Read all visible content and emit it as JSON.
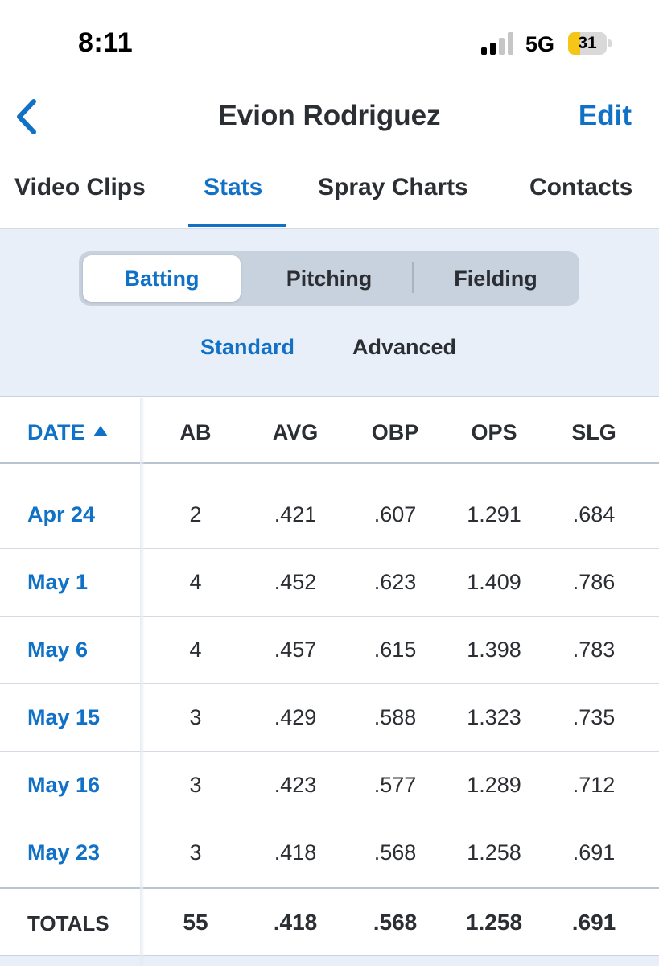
{
  "status_bar": {
    "time": "8:11",
    "network": "5G",
    "battery_level": "31",
    "battery_color": "#f5c518"
  },
  "header": {
    "title": "Evion Rodriguez",
    "back_icon": "chevron-left-icon",
    "edit_label": "Edit"
  },
  "tabs": [
    {
      "label": "Video Clips",
      "active": false
    },
    {
      "label": "Stats",
      "active": true
    },
    {
      "label": "Spray Charts",
      "active": false
    },
    {
      "label": "Contacts",
      "active": false
    }
  ],
  "filters": {
    "segments": [
      {
        "label": "Batting",
        "active": true
      },
      {
        "label": "Pitching",
        "active": false
      },
      {
        "label": "Fielding",
        "active": false
      }
    ],
    "subtabs": [
      {
        "label": "Standard",
        "active": true
      },
      {
        "label": "Advanced",
        "active": false
      }
    ]
  },
  "table": {
    "columns": [
      "DATE",
      "AB",
      "AVG",
      "OBP",
      "OPS",
      "SLG"
    ],
    "sort": {
      "column": "DATE",
      "direction": "ascending",
      "icon": "sort-up-icon"
    },
    "rows": [
      {
        "date": "Apr 24",
        "ab": "2",
        "avg": ".421",
        "obp": ".607",
        "ops": "1.291",
        "slg": ".684"
      },
      {
        "date": "May 1",
        "ab": "4",
        "avg": ".452",
        "obp": ".623",
        "ops": "1.409",
        "slg": ".786"
      },
      {
        "date": "May 6",
        "ab": "4",
        "avg": ".457",
        "obp": ".615",
        "ops": "1.398",
        "slg": ".783"
      },
      {
        "date": "May 15",
        "ab": "3",
        "avg": ".429",
        "obp": ".588",
        "ops": "1.323",
        "slg": ".735"
      },
      {
        "date": "May 16",
        "ab": "3",
        "avg": ".423",
        "obp": ".577",
        "ops": "1.289",
        "slg": ".712"
      },
      {
        "date": "May 23",
        "ab": "3",
        "avg": ".418",
        "obp": ".568",
        "ops": "1.258",
        "slg": ".691"
      }
    ],
    "totals": {
      "label": "TOTALS",
      "ab": "55",
      "avg": ".418",
      "obp": ".568",
      "ops": "1.258",
      "slg": ".691"
    }
  },
  "colors": {
    "accent": "#1071c6",
    "text": "#2b2e33",
    "panel": "#e9eff8"
  }
}
